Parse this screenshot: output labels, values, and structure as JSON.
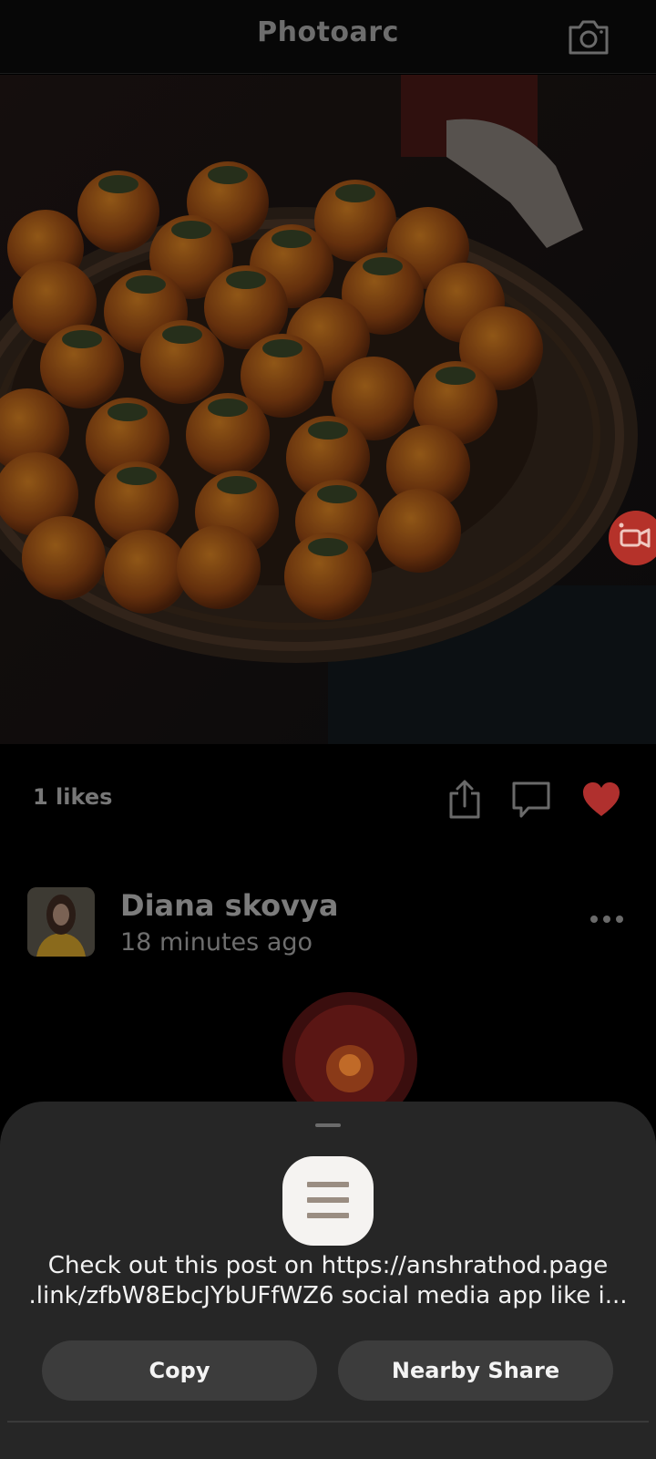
{
  "header": {
    "title": "Photoarc",
    "camera_icon": "camera-icon"
  },
  "post": {
    "image_subject": "",
    "likes_text": "1 likes",
    "actions": {
      "share_icon": "share-icon",
      "comment_icon": "comment-icon",
      "like_icon": "heart-icon",
      "like_color": "#b0302e"
    }
  },
  "next_post": {
    "author": "Diana skovya",
    "time": "18 minutes ago",
    "more_icon": "more-horizontal-icon"
  },
  "record_button": {
    "icon": "video-record-icon",
    "color": "#b5322a"
  },
  "share_sheet": {
    "app_icon": "menu-lines-icon",
    "message_line1": "Check out this post on https://anshrathod.page",
    "message_line2": ".link/zfbW8EbcJYbUFfWZ6 social media app like i...",
    "copy_label": "Copy",
    "nearby_label": "Nearby Share"
  }
}
